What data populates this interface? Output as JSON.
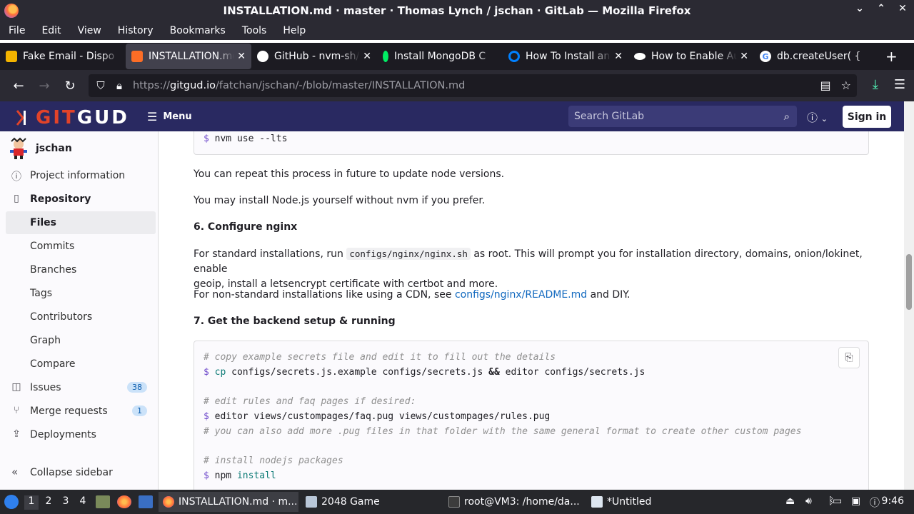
{
  "window": {
    "title": "INSTALLATION.md · master · Thomas Lynch / jschan · GitLab — Mozilla Firefox",
    "controls": [
      "⌄",
      "⌃",
      "✕"
    ]
  },
  "menubar": [
    "File",
    "Edit",
    "View",
    "History",
    "Bookmarks",
    "Tools",
    "Help"
  ],
  "tabs": [
    {
      "label": "Fake Email - Dispo",
      "icon": "mail-icon",
      "color": "#f4b400"
    },
    {
      "label": "INSTALLATION.md",
      "icon": "gitlab-icon",
      "color": "#fc6d26",
      "active": true
    },
    {
      "label": "GitHub - nvm-sh/n",
      "icon": "github-icon",
      "color": "#ffffff"
    },
    {
      "label": "Install MongoDB C",
      "icon": "leaf-icon",
      "color": "#00ed64"
    },
    {
      "label": "How To Install and",
      "icon": "digitalocean-icon",
      "color": "#0080ff"
    },
    {
      "label": "How to Enable Au",
      "icon": "medium-icon",
      "color": "#ffffff"
    },
    {
      "label": "db.createUser( { ",
      "icon": "google-icon",
      "color": "#4285f4"
    }
  ],
  "nav": {
    "url_prefix": "https://",
    "url_host": "gitgud.io",
    "url_path": "/fatchan/jschan/-/blob/master/INSTALLATION.md"
  },
  "gitlab": {
    "logo_git": "GIT",
    "logo_gud": "GUD",
    "menu_label": "Menu",
    "search_placeholder": "Search GitLab",
    "signin_label": "Sign in"
  },
  "sidebar": {
    "project": "jschan",
    "items": [
      {
        "label": "Project information",
        "icon": "info-icon",
        "type": "section-link"
      },
      {
        "label": "Repository",
        "icon": "repository-icon",
        "type": "section"
      },
      {
        "label": "Files",
        "type": "active"
      },
      {
        "label": "Commits"
      },
      {
        "label": "Branches"
      },
      {
        "label": "Tags"
      },
      {
        "label": "Contributors"
      },
      {
        "label": "Graph"
      },
      {
        "label": "Compare"
      },
      {
        "label": "Issues",
        "icon": "issues-icon",
        "badge": "38"
      },
      {
        "label": "Merge requests",
        "icon": "merge-request-icon",
        "badge": "1"
      },
      {
        "label": "Deployments",
        "icon": "deployments-icon"
      }
    ],
    "collapse_label": "Collapse sidebar"
  },
  "content": {
    "code_top": {
      "prompt": "$",
      "cmd": "nvm use --lts"
    },
    "p1": "You can repeat this process in future to update node versions.",
    "p2": "You may install Node.js yourself without nvm if you prefer.",
    "h6": "6. Configure nginx",
    "p3_a": "For standard installations, run ",
    "p3_code": "configs/nginx/nginx.sh",
    "p3_b": " as root. This will prompt you for installation directory, domains, onion/lokinet, enable",
    "p3_c": "geoip, install a letsencrypt certificate with certbot and more.",
    "p4_a": "For non-standard installations like using a CDN, see ",
    "p4_link": "configs/nginx/README.md",
    "p4_b": " and DIY.",
    "h7": "7. Get the backend setup & running",
    "code": {
      "l1": "# copy example secrets file and edit it to fill out the details",
      "l2_prompt": "$",
      "l2_cmd": "cp",
      "l2_a": " configs/secrets.js.example configs/secrets.js ",
      "l2_op": "&&",
      "l2_b": " editor configs/secrets.js",
      "l3": "# edit rules and faq pages if desired:",
      "l4_prompt": "$",
      "l4_rest": " editor views/custompages/faq.pug views/custompages/rules.pug",
      "l5": "# you can also add more .pug files in that folder with the same general format to create other custom pages",
      "l6": "# install nodejs packages",
      "l7_prompt": "$",
      "l7_a": " npm ",
      "l7_cmd": "install"
    }
  },
  "taskbar": {
    "workspaces": [
      "1",
      "2",
      "3",
      "4"
    ],
    "windows": [
      {
        "label": "INSTALLATION.md · m...",
        "active": true
      },
      {
        "label": "2048 Game"
      },
      {
        "label": "root@VM3: /home/da..."
      },
      {
        "label": "*Untitled"
      }
    ],
    "clock": "9:46"
  }
}
